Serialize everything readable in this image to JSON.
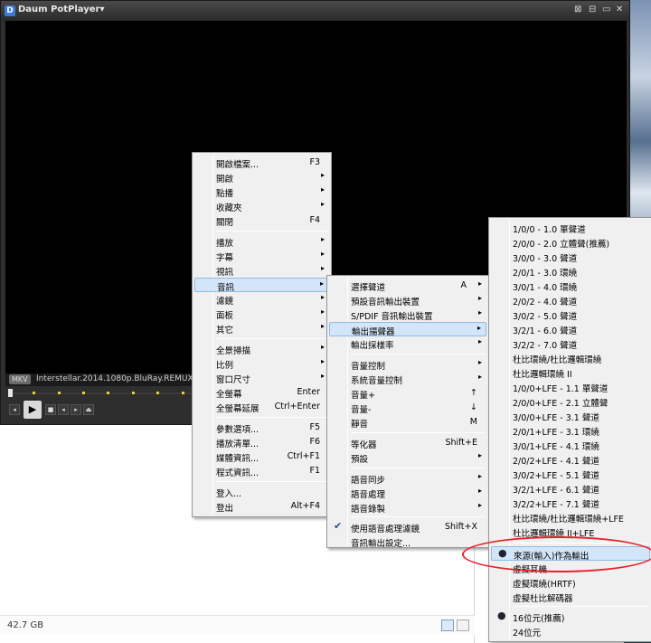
{
  "player": {
    "title": "Daum PotPlayer",
    "title_arrow": "▾",
    "window_controls": [
      "⊠",
      "⊟",
      "▭",
      "✕"
    ],
    "badge": "MKV",
    "filename": "Interstellar.2014.1080p.BluRay.REMUX.AVC.DTS-",
    "play_icon": "▶"
  },
  "explorer": {
    "status_size": "42.7 GB"
  },
  "menu1": {
    "items": [
      {
        "label": "開啟檔案...",
        "shortcut": "F3"
      },
      {
        "label": "開啟",
        "arrow": "▸"
      },
      {
        "label": "點播",
        "arrow": "▸"
      },
      {
        "label": "收藏夾",
        "arrow": "▸"
      },
      {
        "label": "關閉",
        "shortcut": "F4"
      },
      {
        "label": "播放",
        "arrow": "▸"
      },
      {
        "label": "字幕",
        "arrow": "▸"
      },
      {
        "label": "視訊",
        "arrow": "▸"
      },
      {
        "label": "音訊",
        "arrow": "▸",
        "highlight": true
      },
      {
        "label": "濾鏡",
        "arrow": "▸"
      },
      {
        "label": "面板",
        "arrow": "▸"
      },
      {
        "label": "其它",
        "arrow": "▸"
      },
      {
        "label": "全景掃描",
        "arrow": "▸"
      },
      {
        "label": "比例",
        "arrow": "▸"
      },
      {
        "label": "窗口尺寸",
        "arrow": "▸"
      },
      {
        "label": "全螢幕",
        "shortcut": "Enter"
      },
      {
        "label": "全螢幕延展",
        "shortcut": "Ctrl+Enter"
      },
      {
        "label": "參數選項...",
        "shortcut": "F5"
      },
      {
        "label": "播放清單...",
        "shortcut": "F6"
      },
      {
        "label": "媒體資訊...",
        "shortcut": "Ctrl+F1"
      },
      {
        "label": "程式資訊...",
        "shortcut": "F1"
      },
      {
        "label": "登入..."
      },
      {
        "label": "登出",
        "shortcut": "Alt+F4"
      }
    ]
  },
  "menu2": {
    "items": [
      {
        "label": "選擇聲道",
        "shortcut": "A",
        "arrow": "▸"
      },
      {
        "label": "預設音訊輸出裝置",
        "arrow": "▸"
      },
      {
        "label": "S/PDIF 音訊輸出裝置",
        "arrow": "▸"
      },
      {
        "label": "輸出揚聲器",
        "arrow": "▸",
        "highlight": true
      },
      {
        "label": "輸出採樣率",
        "arrow": "▸"
      },
      {
        "label": "音量控制",
        "arrow": "▸"
      },
      {
        "label": "系統音量控制",
        "arrow": "▸"
      },
      {
        "label": "音量+",
        "shortcut": "↑"
      },
      {
        "label": "音量-",
        "shortcut": "↓"
      },
      {
        "label": "靜音",
        "shortcut": "M"
      },
      {
        "label": "等化器",
        "shortcut": "Shift+E"
      },
      {
        "label": "預設",
        "arrow": "▸"
      },
      {
        "label": "語音同步",
        "arrow": "▸"
      },
      {
        "label": "語音處理",
        "arrow": "▸"
      },
      {
        "label": "語音錄製",
        "arrow": "▸"
      },
      {
        "label": "使用語音處理濾鏡",
        "shortcut": "Shift+X",
        "checked": true
      },
      {
        "label": "音訊輸出設定..."
      }
    ]
  },
  "menu3": {
    "items": [
      {
        "label": "1/0/0 - 1.0 單聲道"
      },
      {
        "label": "2/0/0 - 2.0 立體聲(推薦)"
      },
      {
        "label": "3/0/0 - 3.0 聲道"
      },
      {
        "label": "2/0/1 - 3.0 環繞"
      },
      {
        "label": "3/0/1 - 4.0 環繞"
      },
      {
        "label": "2/0/2 - 4.0 聲道"
      },
      {
        "label": "3/0/2 - 5.0 聲道"
      },
      {
        "label": "3/2/1 - 6.0 聲道"
      },
      {
        "label": "3/2/2 - 7.0 聲道"
      },
      {
        "label": "杜比環繞/杜比邏輯環繞"
      },
      {
        "label": "杜比邏輯環繞 II"
      },
      {
        "label": "1/0/0+LFE - 1.1 單聲道"
      },
      {
        "label": "2/0/0+LFE - 2.1 立體聲"
      },
      {
        "label": "3/0/0+LFE - 3.1 聲道"
      },
      {
        "label": "2/0/1+LFE - 3.1 環繞"
      },
      {
        "label": "3/0/1+LFE - 4.1 環繞"
      },
      {
        "label": "2/0/2+LFE - 4.1 聲道"
      },
      {
        "label": "3/0/2+LFE - 5.1 聲道"
      },
      {
        "label": "3/2/1+LFE - 6.1 聲道"
      },
      {
        "label": "3/2/2+LFE - 7.1 聲道"
      },
      {
        "label": "杜比環繞/杜比邏輯環繞+LFE"
      },
      {
        "label": "杜比邏輯環繞 II+LFE"
      },
      {
        "label": "來源(輸入)作為輸出",
        "selected": true,
        "highlight": true
      },
      {
        "label": "虛擬耳機"
      },
      {
        "label": "虛擬環繞(HRTF)"
      },
      {
        "label": "虛擬杜比解碼器"
      },
      {
        "label": "16位元(推薦)",
        "selected": true
      },
      {
        "label": "24位元"
      }
    ]
  },
  "colors": {
    "highlight": "#d3e5f9",
    "annotation": "#e8222b"
  }
}
